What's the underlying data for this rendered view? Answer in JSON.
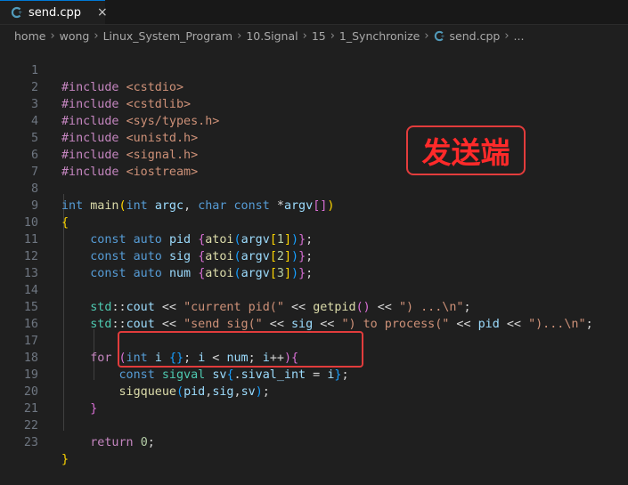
{
  "tab": {
    "filename": "send.cpp",
    "file_icon": "cpp-file-icon",
    "close_glyph": "×"
  },
  "breadcrumb": [
    {
      "label": "home"
    },
    {
      "label": "wong"
    },
    {
      "label": "Linux_System_Program"
    },
    {
      "label": "10.Signal"
    },
    {
      "label": "15"
    },
    {
      "label": "1_Synchronize"
    },
    {
      "label": "send.cpp"
    },
    {
      "label": "..."
    }
  ],
  "line_numbers": [
    "1",
    "2",
    "3",
    "4",
    "5",
    "6",
    "7",
    "8",
    "9",
    "10",
    "11",
    "12",
    "13",
    "14",
    "15",
    "16",
    "17",
    "18",
    "19",
    "20",
    "21",
    "22",
    "23"
  ],
  "annotation": {
    "label": "发送端",
    "color": "#e23c3c"
  },
  "code": {
    "l1": [
      "#include",
      " ",
      "<cstdio>"
    ],
    "l2": [
      "#include",
      " ",
      "<cstdlib>"
    ],
    "l3": [
      "#include",
      " ",
      "<sys/types.h>"
    ],
    "l4": [
      "#include",
      " ",
      "<unistd.h>"
    ],
    "l5": [
      "#include",
      " ",
      "<signal.h>"
    ],
    "l6": [
      "#include",
      " ",
      "<iostream>"
    ],
    "l8": [
      "int",
      " ",
      "main",
      "(",
      "int",
      " ",
      "argc",
      ", ",
      "char",
      " ",
      "const",
      " *",
      "argv",
      "[]",
      ")"
    ],
    "l9": [
      "{"
    ],
    "l10": [
      "    ",
      "const",
      " ",
      "auto",
      " ",
      "pid",
      " ",
      "{",
      "atoi",
      "(",
      "argv",
      "[",
      "1",
      "]",
      ")",
      "}",
      ";"
    ],
    "l11": [
      "    ",
      "const",
      " ",
      "auto",
      " ",
      "sig",
      " ",
      "{",
      "atoi",
      "(",
      "argv",
      "[",
      "2",
      "]",
      ")",
      "}",
      ";"
    ],
    "l12": [
      "    ",
      "const",
      " ",
      "auto",
      " ",
      "num",
      " ",
      "{",
      "atoi",
      "(",
      "argv",
      "[",
      "3",
      "]",
      ")",
      "}",
      ";"
    ],
    "l14": [
      "    ",
      "std",
      "::",
      "cout",
      " << ",
      "\"current pid(\"",
      " << ",
      "getpid",
      "()",
      " << ",
      "\") ...\\n\"",
      ";"
    ],
    "l15": [
      "    ",
      "std",
      "::",
      "cout",
      " << ",
      "\"send sig(\"",
      " << ",
      "sig",
      " << ",
      "\") to process(\"",
      " << ",
      "pid",
      " << ",
      "\")...\\n\"",
      ";"
    ],
    "l17": [
      "    ",
      "for",
      " ",
      "(",
      "int",
      " ",
      "i",
      " ",
      "{}",
      "; ",
      "i",
      " < ",
      "num",
      "; ",
      "i",
      "++",
      ")",
      "{"
    ],
    "l18": [
      "        ",
      "const",
      " ",
      "sigval",
      " ",
      "sv",
      "{",
      ".",
      "sival_int",
      " = ",
      "i",
      "}",
      ";"
    ],
    "l19": [
      "        ",
      "sigqueue",
      "(",
      "pid",
      ",",
      "sig",
      ",",
      "sv",
      ")",
      ";"
    ],
    "l20": [
      "    ",
      "}"
    ],
    "l22": [
      "    ",
      "return",
      " ",
      "0",
      ";"
    ],
    "l23": [
      "}"
    ]
  },
  "colors": {
    "background": "#1f1f1f",
    "keyword": "#569cd6",
    "control": "#c586c0",
    "string": "#ce9178",
    "function": "#dcdcaa",
    "variable": "#9cdcfe",
    "number": "#b5cea8",
    "highlight_box": "#e23c3c"
  }
}
